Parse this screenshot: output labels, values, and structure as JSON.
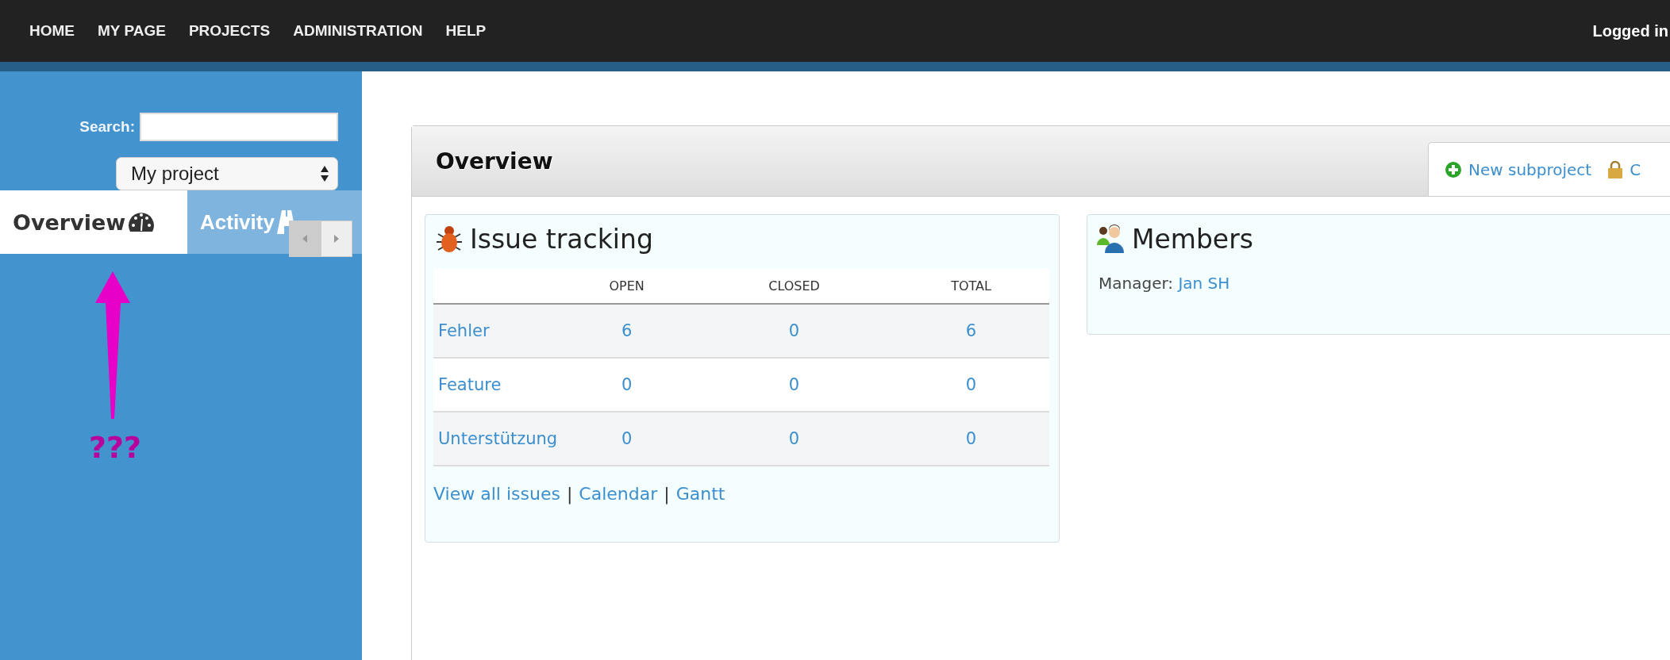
{
  "top_menu": [
    {
      "label": "HOME"
    },
    {
      "label": "MY PAGE"
    },
    {
      "label": "PROJECTS"
    },
    {
      "label": "ADMINISTRATION"
    },
    {
      "label": "HELP"
    }
  ],
  "logged_in": "Logged in",
  "sidebar": {
    "search_label": "Search:",
    "project_select": "My project",
    "tabs": [
      {
        "label": "Overview",
        "selected": true,
        "kind": "gauge"
      },
      {
        "label": "Activity",
        "selected": false,
        "kind": "road"
      }
    ],
    "annotation": "???"
  },
  "page_title": "Overview",
  "contextual": [
    {
      "label": "New subproject",
      "kind": "add"
    },
    {
      "label": "C",
      "kind": "lock"
    }
  ],
  "issue_tracking": {
    "title": "Issue tracking",
    "columns": [
      "OPEN",
      "CLOSED",
      "TOTAL"
    ],
    "rows": [
      {
        "tracker": "Fehler",
        "open": "6",
        "closed": "0",
        "total": "6"
      },
      {
        "tracker": "Feature",
        "open": "0",
        "closed": "0",
        "total": "0"
      },
      {
        "tracker": "Unterstützung",
        "open": "0",
        "closed": "0",
        "total": "0"
      }
    ],
    "links": [
      "View all issues",
      "Calendar",
      "Gantt"
    ],
    "separator": "|"
  },
  "members": {
    "title": "Members",
    "role": "Manager:",
    "name": "Jan SH"
  }
}
